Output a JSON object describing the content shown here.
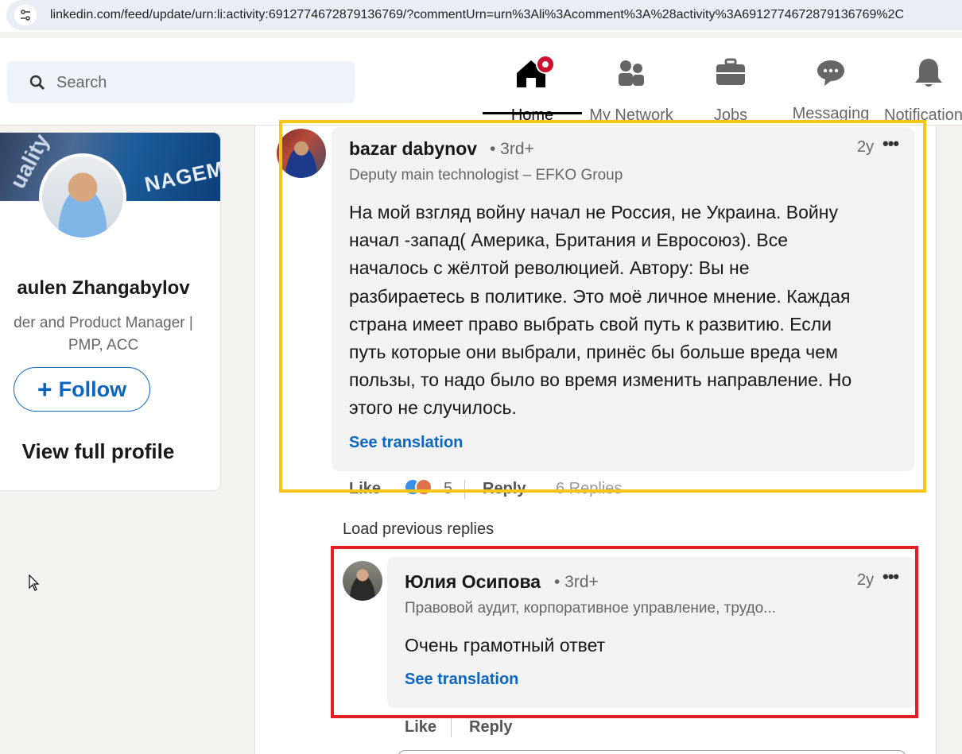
{
  "browser": {
    "url": "linkedin.com/feed/update/urn:li:activity:6912774672879136769/?commentUrn=urn%3Ali%3Acomment%3A%28activity%3A6912774672879136769%2C"
  },
  "header": {
    "search_placeholder": "Search",
    "nav": [
      {
        "label": "Home",
        "icon": "home-icon",
        "active": true,
        "badge": true
      },
      {
        "label": "My Network",
        "icon": "network-icon"
      },
      {
        "label": "Jobs",
        "icon": "briefcase-icon"
      },
      {
        "label": "Messaging",
        "icon": "messaging-icon"
      },
      {
        "label": "Notifications",
        "icon": "bell-icon"
      }
    ]
  },
  "profile_card": {
    "name": "aulen Zhangabylov",
    "headline_line1": "der and Product Manager |",
    "headline_line2": "PMP, ACC",
    "follow_label": "Follow",
    "view_profile_label": "View full profile",
    "banner_text": "NAGEMEN",
    "banner_text2": "uality"
  },
  "comment": {
    "author": "bazar dabynov",
    "degree": "• 3rd+",
    "headline": "Deputy main technologist – EFKO Group",
    "time": "2y",
    "body_lines": [
      "На мой взгляд войну начал не Россия, не Украина. Войну",
      "начал -запад( Америка, Британия и Евросоюз). Все",
      "началось с жёлтой революцией. Автору: Вы не",
      "разбираетесь в политике. Это моё личное мнение. Каждая",
      "страна имеет право выбрать свой путь к развитию. Если",
      "путь которые они выбрали, принёс бы больше вреда чем",
      "пользы, то надо было во время изменить направление. Но",
      "этого не случилось."
    ],
    "see_translation": "See translation",
    "like_label": "Like",
    "reaction_count": "5",
    "reply_label": "Reply",
    "replies_count": "6 Replies"
  },
  "load_previous": "Load previous replies",
  "reply": {
    "author": "Юлия Осипова",
    "degree": "• 3rd+",
    "headline": "Правовой аудит, корпоративное управление, трудо...",
    "time": "2y",
    "body": "Очень грамотный ответ",
    "see_translation": "See translation",
    "like_label": "Like",
    "reply_label": "Reply"
  },
  "colors": {
    "highlight_yellow": "#f5c518",
    "highlight_red": "#e02025",
    "link_blue": "#0a66c2"
  }
}
